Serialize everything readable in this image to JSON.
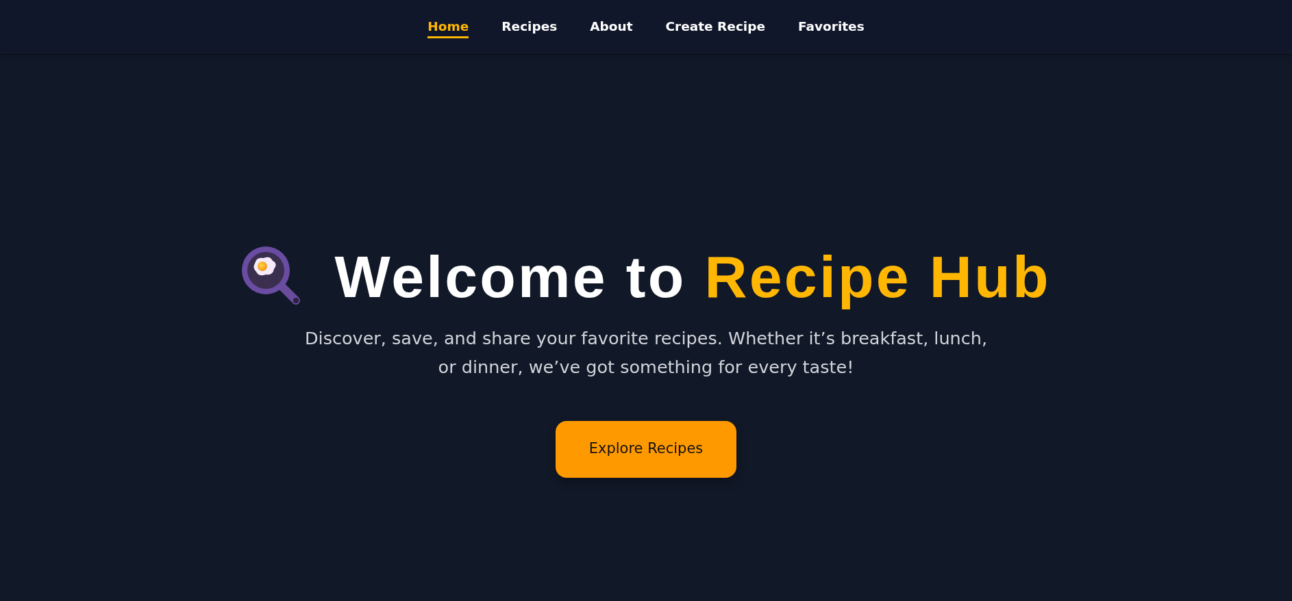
{
  "nav": {
    "items": [
      {
        "label": "Home",
        "selected": true
      },
      {
        "label": "Recipes",
        "selected": false
      },
      {
        "label": "About",
        "selected": false
      },
      {
        "label": "Create Recipe",
        "selected": false
      },
      {
        "label": "Favorites",
        "selected": false
      }
    ]
  },
  "hero": {
    "title": "Welcome to",
    "title_highlight": "Recipe Hub",
    "subtitle": "Discover, save, and share your favorite recipes. Whether it’s breakfast, lunch, or dinner, we’ve got something for every taste!",
    "button": "Explore Recipes"
  }
}
